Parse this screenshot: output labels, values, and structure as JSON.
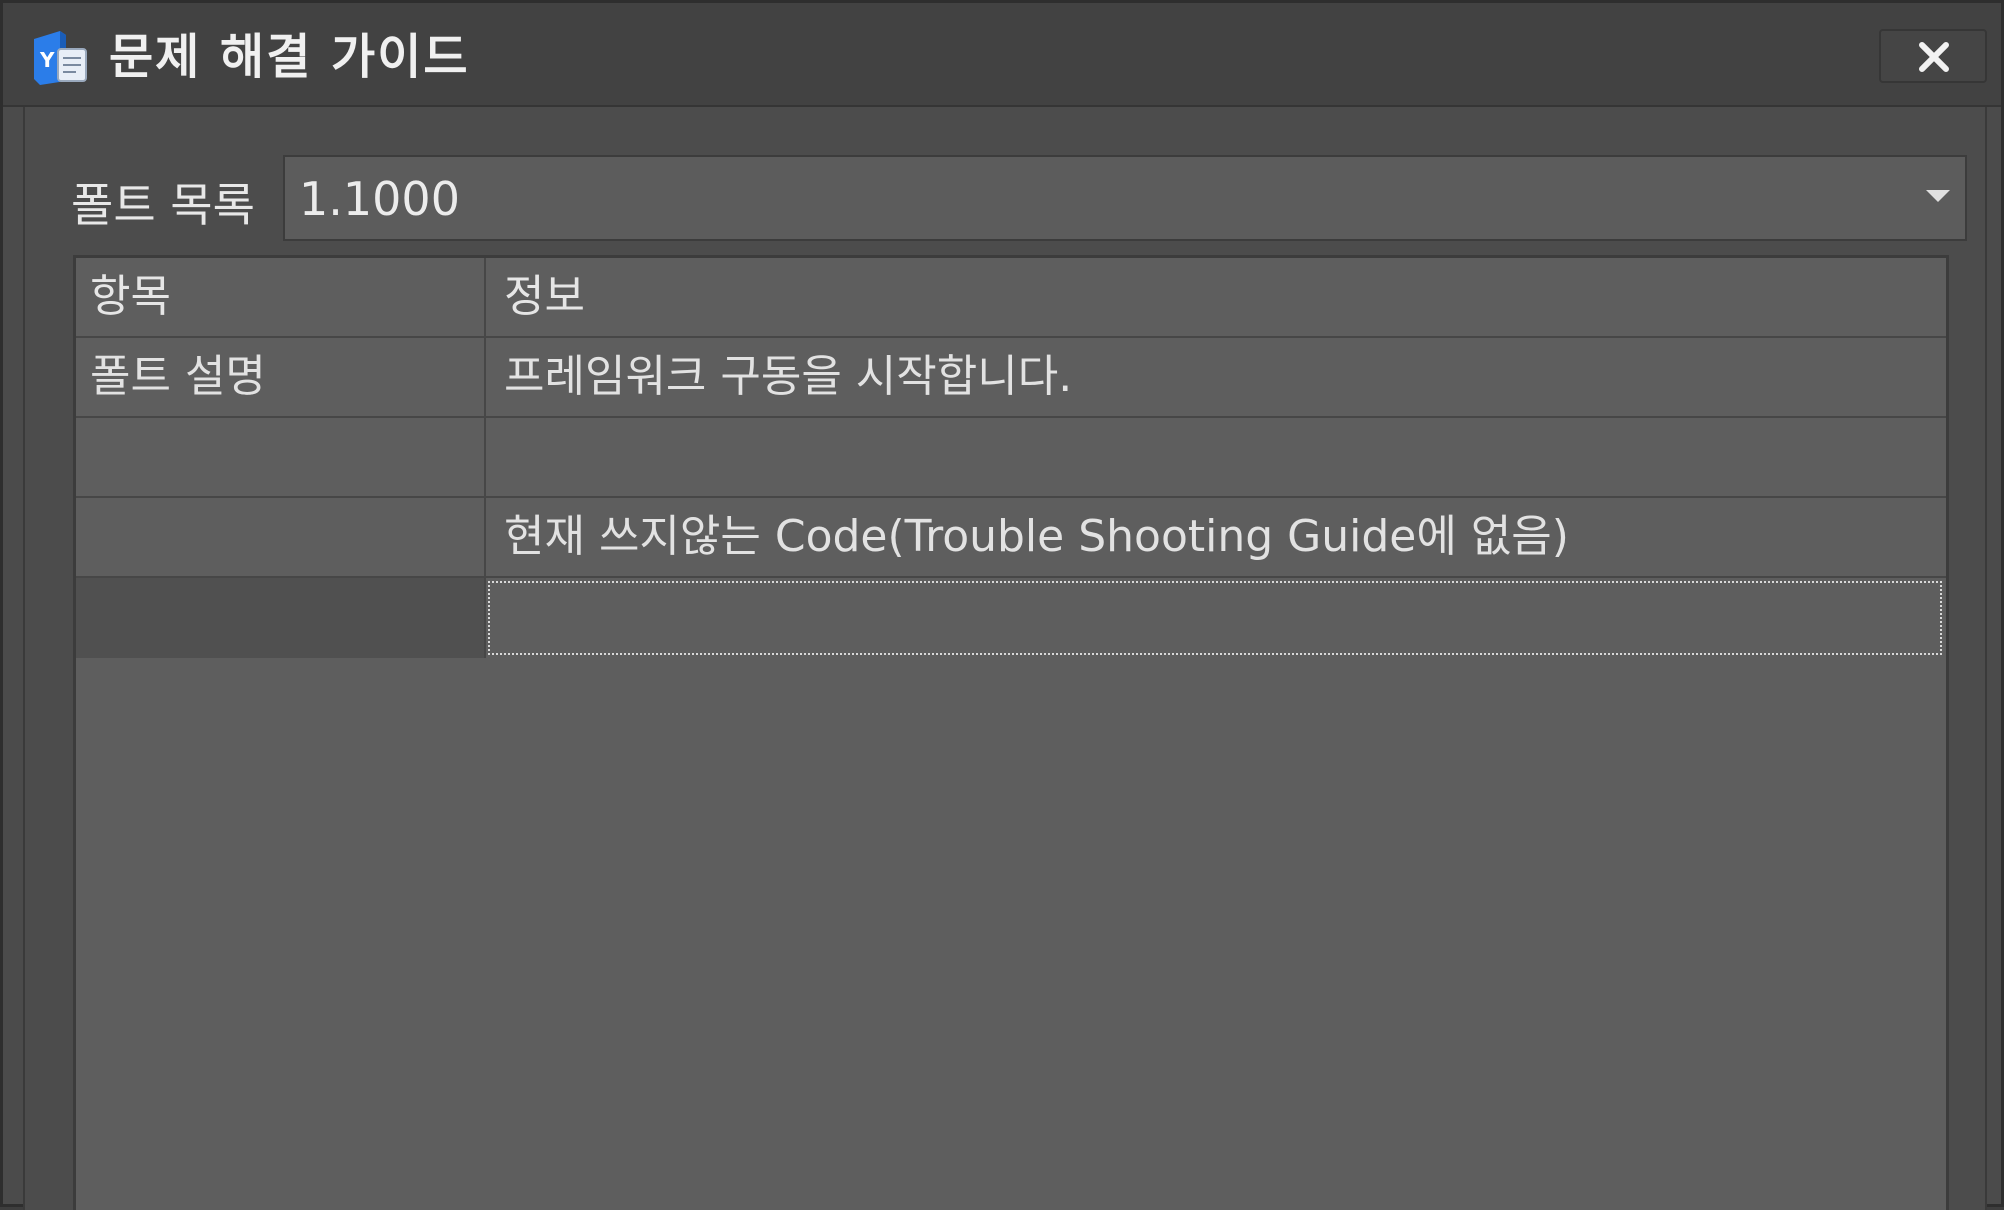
{
  "window": {
    "title": "문제 해결 가이드",
    "close_symbol": "✕"
  },
  "icons": {
    "app": "app-logo-icon",
    "close": "close-icon",
    "dropdown": "chevron-down-icon"
  },
  "colors": {
    "app_icon_blue": "#2b7de9",
    "background": "#4c4c4c",
    "grid_background": "#5e5e5e"
  },
  "font_list": {
    "label": "폴트 목록",
    "selected_value": "1.1000"
  },
  "grid": {
    "columns": [
      "항목",
      "정보"
    ],
    "rows": [
      {
        "item": "폴트 설명",
        "info": "프레임워크 구동을 시작합니다."
      },
      {
        "item": "",
        "info": ""
      },
      {
        "item": "",
        "info": "현재 쓰지않는 Code(Trouble Shooting Guide에 없음)"
      },
      {
        "item": "",
        "info": ""
      }
    ]
  }
}
